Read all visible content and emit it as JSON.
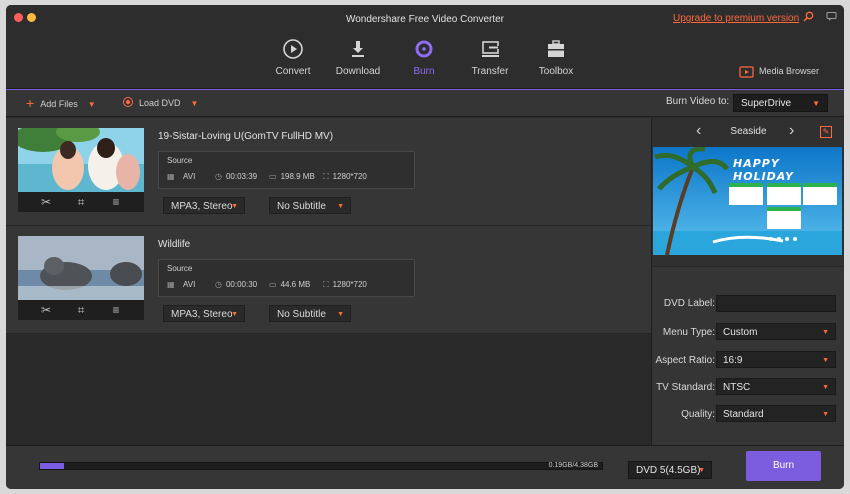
{
  "window": {
    "title": "Wondershare Free Video Converter",
    "upgrade_link": "Upgrade to premium version"
  },
  "nav": {
    "tabs": [
      {
        "label": "Convert",
        "icon": "convert-icon"
      },
      {
        "label": "Download",
        "icon": "download-icon"
      },
      {
        "label": "Burn",
        "icon": "burn-icon",
        "active": true
      },
      {
        "label": "Transfer",
        "icon": "transfer-icon"
      },
      {
        "label": "Toolbox",
        "icon": "toolbox-icon"
      }
    ],
    "media_browser": "Media Browser"
  },
  "toolbar": {
    "add_files": "Add Files",
    "load_dvd": "Load DVD",
    "burn_to_label": "Burn Video to:",
    "burn_to_value": "SuperDrive"
  },
  "items": [
    {
      "title": "19-Sistar-Loving U(GomTV FullHD MV)",
      "source_label": "Source",
      "format": "AVI",
      "duration": "00:03:39",
      "size": "198.9 MB",
      "resolution": "1280*720",
      "audio": "MPA3, Stereo",
      "subtitle": "No Subtitle"
    },
    {
      "title": "Wildlife",
      "source_label": "Source",
      "format": "AVI",
      "duration": "00:00:30",
      "size": "44.6 MB",
      "resolution": "1280*720",
      "audio": "MPA3, Stereo",
      "subtitle": "No Subtitle"
    }
  ],
  "theme": {
    "name": "Seaside",
    "preview_text": "HAPPY HOLIDAY"
  },
  "settings": {
    "dvd_label": {
      "label": "DVD Label:",
      "value": ""
    },
    "menu_type": {
      "label": "Menu Type:",
      "value": "Custom"
    },
    "aspect_ratio": {
      "label": "Aspect Ratio:",
      "value": "16:9"
    },
    "tv_standard": {
      "label": "TV Standard:",
      "value": "NTSC"
    },
    "quality": {
      "label": "Quality:",
      "value": "Standard"
    }
  },
  "bottom": {
    "usage_text": "0.19GB/4.38GB",
    "usage_fraction": 0.043,
    "disc": "DVD 5(4.5GB)",
    "burn_button": "Burn"
  },
  "colors": {
    "accent": "#7c5ddf",
    "highlight": "#ff6a3d"
  }
}
